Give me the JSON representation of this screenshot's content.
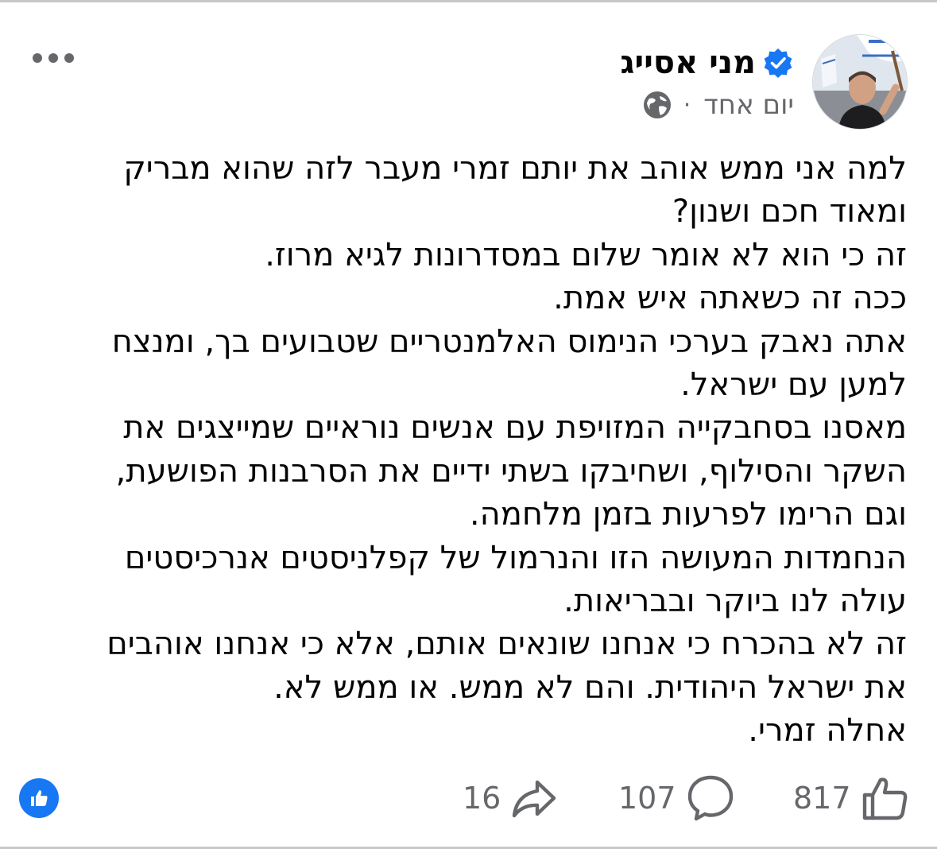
{
  "post": {
    "author_name": "מני אסייג",
    "timestamp": "יום אחד",
    "meta_separator": "·",
    "more_label": "•••",
    "body_lines": [
      "למה אני ממש אוהב את יותם זמרי מעבר לזה שהוא מבריק",
      "ומאוד חכם ושנון?",
      "זה כי הוא לא אומר שלום במסדרונות לגיא מרוז.",
      "ככה זה כשאתה איש אמת.",
      "אתה נאבק בערכי הנימוס האלמנטריים שטבועים בך, ומנצח",
      "למען עם ישראל.",
      "מאסנו בסחבקייה המזויפת עם אנשים נוראיים שמייצגים את",
      "השקר והסילוף, ושחיבקו בשתי ידיים את הסרבנות הפושעת,",
      "וגם הרימו לפרעות בזמן מלחמה.",
      "הנחמדות המעושה הזו והנרמול של קפלניסטים אנרכיסטים",
      "עולה לנו ביוקר ובבריאות.",
      "זה לא בהכרח כי אנחנו שונאים אותם, אלא כי אנחנו אוהבים",
      "את ישראל היהודית. והם לא ממש. או ממש לא.",
      "אחלה זמרי."
    ]
  },
  "actions": {
    "likes": "817",
    "comments": "107",
    "shares": "16"
  },
  "icons": {
    "verified": "verified-badge-icon",
    "globe": "globe-icon",
    "more": "more-options-icon",
    "like_badge": "like-reaction-icon",
    "like": "thumbs-up-icon",
    "comment": "comment-bubble-icon",
    "share": "share-arrow-icon"
  },
  "colors": {
    "facebook_blue": "#1877f2",
    "text_primary": "#050505",
    "text_secondary": "#65676b"
  }
}
